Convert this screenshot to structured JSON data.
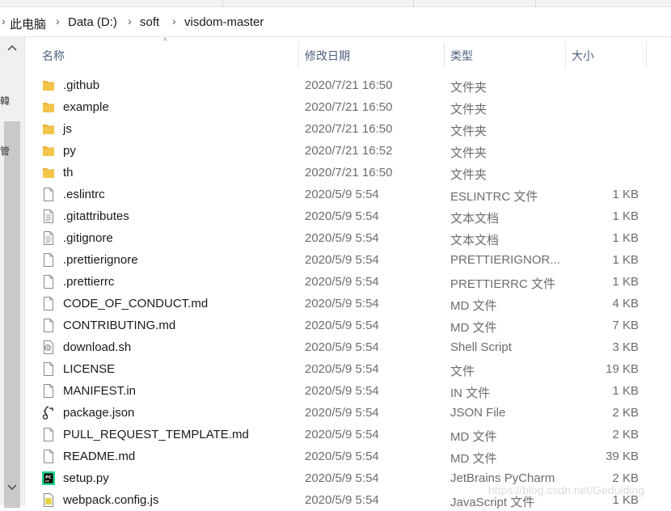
{
  "breadcrumb": [
    "此电脑",
    "Data (D:)",
    "soft",
    "visdom-master"
  ],
  "sidebar_fragments": [
    "韓",
    "管"
  ],
  "columns": {
    "name": "名称",
    "date": "修改日期",
    "type": "类型",
    "size": "大小"
  },
  "files": [
    {
      "name": ".github",
      "date": "2020/7/21 16:50",
      "type": "文件夹",
      "size": "",
      "icon": "folder-icon"
    },
    {
      "name": "example",
      "date": "2020/7/21 16:50",
      "type": "文件夹",
      "size": "",
      "icon": "folder-icon"
    },
    {
      "name": "js",
      "date": "2020/7/21 16:50",
      "type": "文件夹",
      "size": "",
      "icon": "folder-icon"
    },
    {
      "name": "py",
      "date": "2020/7/21 16:52",
      "type": "文件夹",
      "size": "",
      "icon": "folder-icon"
    },
    {
      "name": "th",
      "date": "2020/7/21 16:50",
      "type": "文件夹",
      "size": "",
      "icon": "folder-icon"
    },
    {
      "name": ".eslintrc",
      "date": "2020/5/9 5:54",
      "type": "ESLINTRC 文件",
      "size": "1 KB",
      "icon": "file-icon"
    },
    {
      "name": ".gitattributes",
      "date": "2020/5/9 5:54",
      "type": "文本文档",
      "size": "1 KB",
      "icon": "text-file-icon"
    },
    {
      "name": ".gitignore",
      "date": "2020/5/9 5:54",
      "type": "文本文档",
      "size": "1 KB",
      "icon": "text-file-icon"
    },
    {
      "name": ".prettierignore",
      "date": "2020/5/9 5:54",
      "type": "PRETTIERIGNOR...",
      "size": "1 KB",
      "icon": "file-icon"
    },
    {
      "name": ".prettierrc",
      "date": "2020/5/9 5:54",
      "type": "PRETTIERRC 文件",
      "size": "1 KB",
      "icon": "file-icon"
    },
    {
      "name": "CODE_OF_CONDUCT.md",
      "date": "2020/5/9 5:54",
      "type": "MD 文件",
      "size": "4 KB",
      "icon": "file-icon"
    },
    {
      "name": "CONTRIBUTING.md",
      "date": "2020/5/9 5:54",
      "type": "MD 文件",
      "size": "7 KB",
      "icon": "file-icon"
    },
    {
      "name": "download.sh",
      "date": "2020/5/9 5:54",
      "type": "Shell Script",
      "size": "3 KB",
      "icon": "shell-script-icon"
    },
    {
      "name": "LICENSE",
      "date": "2020/5/9 5:54",
      "type": "文件",
      "size": "19 KB",
      "icon": "file-icon"
    },
    {
      "name": "MANIFEST.in",
      "date": "2020/5/9 5:54",
      "type": "IN 文件",
      "size": "1 KB",
      "icon": "file-icon"
    },
    {
      "name": "package.json",
      "date": "2020/5/9 5:54",
      "type": "JSON File",
      "size": "2 KB",
      "icon": "json-file-icon"
    },
    {
      "name": "PULL_REQUEST_TEMPLATE.md",
      "date": "2020/5/9 5:54",
      "type": "MD 文件",
      "size": "2 KB",
      "icon": "file-icon"
    },
    {
      "name": "README.md",
      "date": "2020/5/9 5:54",
      "type": "MD 文件",
      "size": "39 KB",
      "icon": "file-icon"
    },
    {
      "name": "setup.py",
      "date": "2020/5/9 5:54",
      "type": "JetBrains PyCharm",
      "size": "2 KB",
      "icon": "pycharm-file-icon"
    },
    {
      "name": "webpack.config.js",
      "date": "2020/5/9 5:54",
      "type": "JavaScript 文件",
      "size": "1 KB",
      "icon": "js-file-icon"
    }
  ],
  "watermark": "https://blog.csdn.net/Gedulding",
  "colors": {
    "header_text": "#4d6082",
    "folder": "#f4c54a",
    "selected_scroll": "#c9c9c9"
  }
}
